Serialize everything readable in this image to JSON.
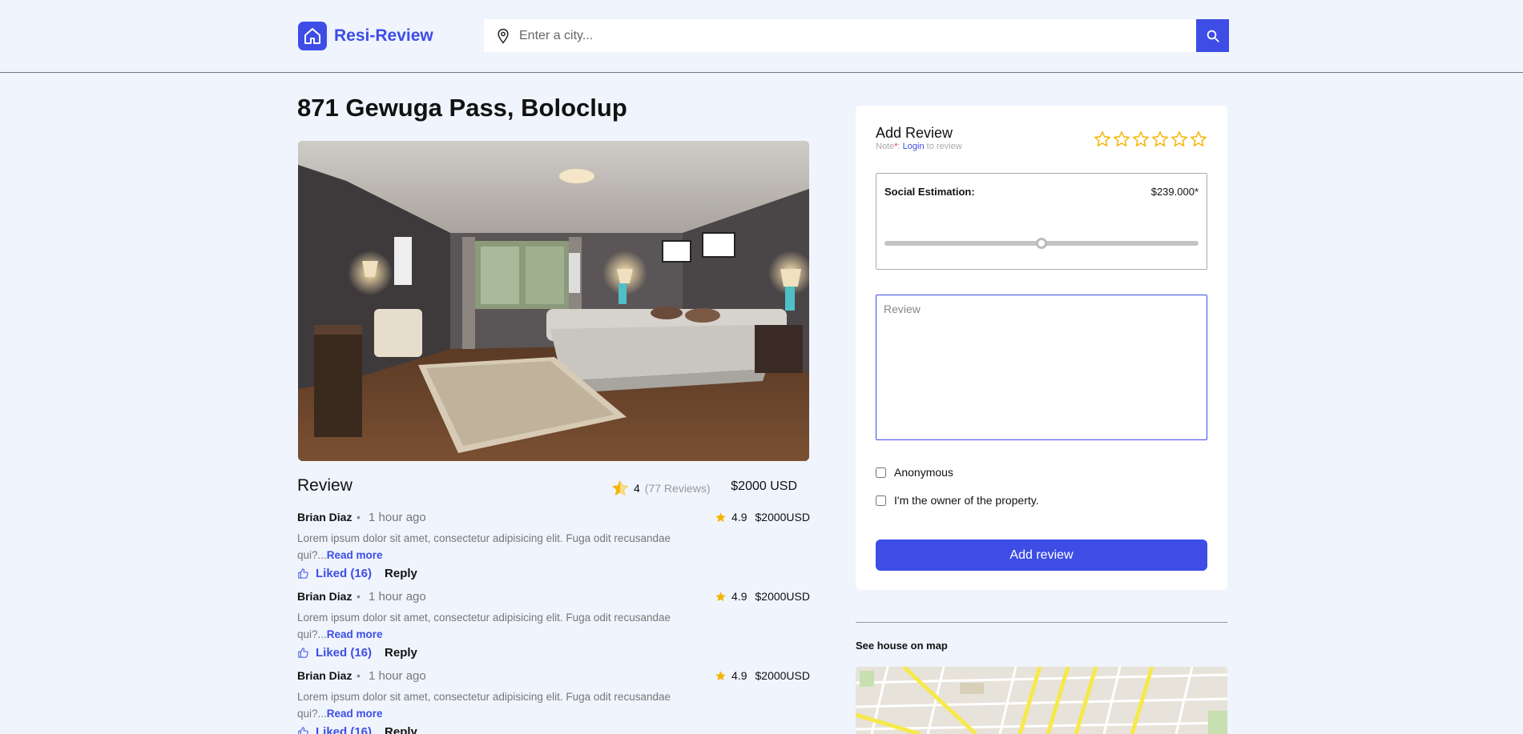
{
  "brand": {
    "name": "Resi-Review",
    "color": "#3d4de6"
  },
  "search": {
    "placeholder": "Enter a city...",
    "value": ""
  },
  "property": {
    "title": "871 Gewuga Pass, Boloclup",
    "rating": "4",
    "reviews_count": "(77 Reviews)",
    "price": "$2000 USD"
  },
  "reviews_section": {
    "title": "Review"
  },
  "comments": [
    {
      "name": "Brian Diaz",
      "time": "1 hour ago",
      "rating": "4.9",
      "price": "$2000USD",
      "text": "Lorem ipsum dolor sit amet, consectetur adipisicing elit. Fuga odit recusandae qui?...",
      "read_more": "Read more",
      "liked": "Liked (16)",
      "reply": "Reply"
    },
    {
      "name": "Brian Diaz",
      "time": "1 hour ago",
      "rating": "4.9",
      "price": "$2000USD",
      "text": "Lorem ipsum dolor sit amet, consectetur adipisicing elit. Fuga odit recusandae qui?...",
      "read_more": "Read more",
      "liked": "Liked (16)",
      "reply": "Reply"
    },
    {
      "name": "Brian Diaz",
      "time": "1 hour ago",
      "rating": "4.9",
      "price": "$2000USD",
      "text": "Lorem ipsum dolor sit amet, consectetur adipisicing elit. Fuga odit recusandae qui?...",
      "read_more": "Read more",
      "liked": "Liked (16)",
      "reply": "Reply"
    }
  ],
  "add_review": {
    "title": "Add Review",
    "note_prefix": "Note",
    "note_mark": "*",
    "note_sep": ": ",
    "login_link": "Login",
    "note_suffix": " to review",
    "star_count": 6,
    "estimation_label": "Social Estimation:",
    "estimation_value": "$239.000*",
    "slider_level": 0.5,
    "review_placeholder": "Review",
    "anonymous_label": "Anonymous",
    "owner_label": "I'm the owner of the property.",
    "submit_label": "Add review"
  },
  "map": {
    "label": "See house on map"
  },
  "icons": {
    "logo": "home-icon",
    "search_pin": "map-pin-icon",
    "search_button": "search-icon",
    "rating_star": "star-icon",
    "like": "thumbs-up-icon",
    "empty_star": "star-outline-icon"
  },
  "colors": {
    "accent": "#3d4de6",
    "star": "#f5b400",
    "background": "#eff4fd"
  }
}
